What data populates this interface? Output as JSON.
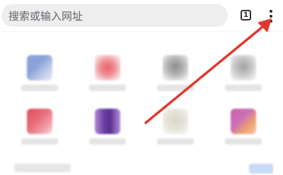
{
  "search": {
    "placeholder": "搜索或输入网址"
  },
  "toolbar": {
    "tab_count": "1",
    "menu_icon": "vertical-ellipsis"
  },
  "shortcuts": [
    {
      "colors": [
        "#8aa3d9",
        "#bfcbe8"
      ]
    },
    {
      "colors": [
        "#e8636c",
        "#f0b9bd"
      ]
    },
    {
      "colors": [
        "#8d8d8d",
        "#cfcfcf"
      ]
    },
    {
      "colors": [
        "#a3a3a3",
        "#d6d6d6"
      ]
    },
    {
      "colors": [
        "#e14b5a",
        "#f1a0a9"
      ]
    },
    {
      "colors": [
        "#6c3fa3",
        "#b28ad6"
      ]
    },
    {
      "colors": [
        "#d9d6c8",
        "#ececec"
      ]
    },
    {
      "colors": [
        "#d25ea8",
        "#f0a070"
      ]
    }
  ],
  "annotation": {
    "arrow_color": "#e0382f"
  }
}
